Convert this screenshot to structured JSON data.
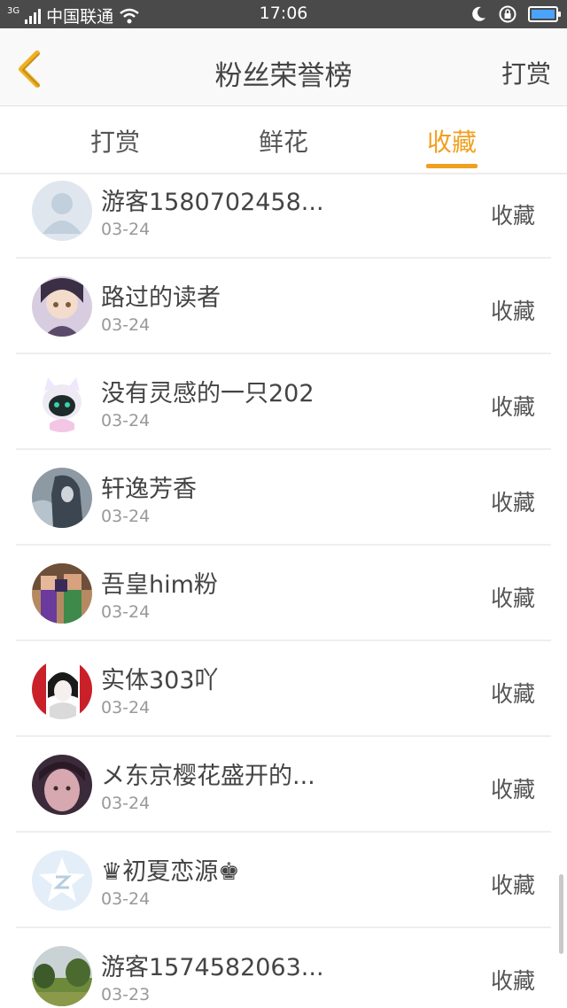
{
  "status_bar": {
    "network": "3G",
    "carrier": "中国联通",
    "time": "17:06"
  },
  "header": {
    "title": "粉丝荣誉榜",
    "action": "打赏"
  },
  "tabs": [
    {
      "label": "打赏",
      "active": false
    },
    {
      "label": "鲜花",
      "active": false
    },
    {
      "label": "收藏",
      "active": true
    }
  ],
  "accent_color": "#f0a020",
  "list": [
    {
      "name": "游客1580702458...",
      "date": "03-24",
      "action": "收藏",
      "avatar": "default-user-avatar"
    },
    {
      "name": "路过的读者",
      "date": "03-24",
      "action": "收藏",
      "avatar": "anime-girl-avatar"
    },
    {
      "name": "没有灵感的一只202",
      "date": "03-24",
      "action": "收藏",
      "avatar": "white-cat-character-avatar"
    },
    {
      "name": "轩逸芳香",
      "date": "03-24",
      "action": "收藏",
      "avatar": "hooded-figure-avatar"
    },
    {
      "name": "吾皇him粉",
      "date": "03-24",
      "action": "收藏",
      "avatar": "game-characters-avatar"
    },
    {
      "name": "实体303吖",
      "date": "03-24",
      "action": "收藏",
      "avatar": "red-white-character-avatar"
    },
    {
      "name": "メ东京樱花盛开的...",
      "date": "03-24",
      "action": "收藏",
      "avatar": "girl-photo-avatar"
    },
    {
      "name": "♛初夏恋源♚",
      "date": "03-24",
      "action": "收藏",
      "avatar": "qq-star-avatar"
    },
    {
      "name": "游客1574582063...",
      "date": "03-23",
      "action": "收藏",
      "avatar": "landscape-photo-avatar"
    }
  ]
}
